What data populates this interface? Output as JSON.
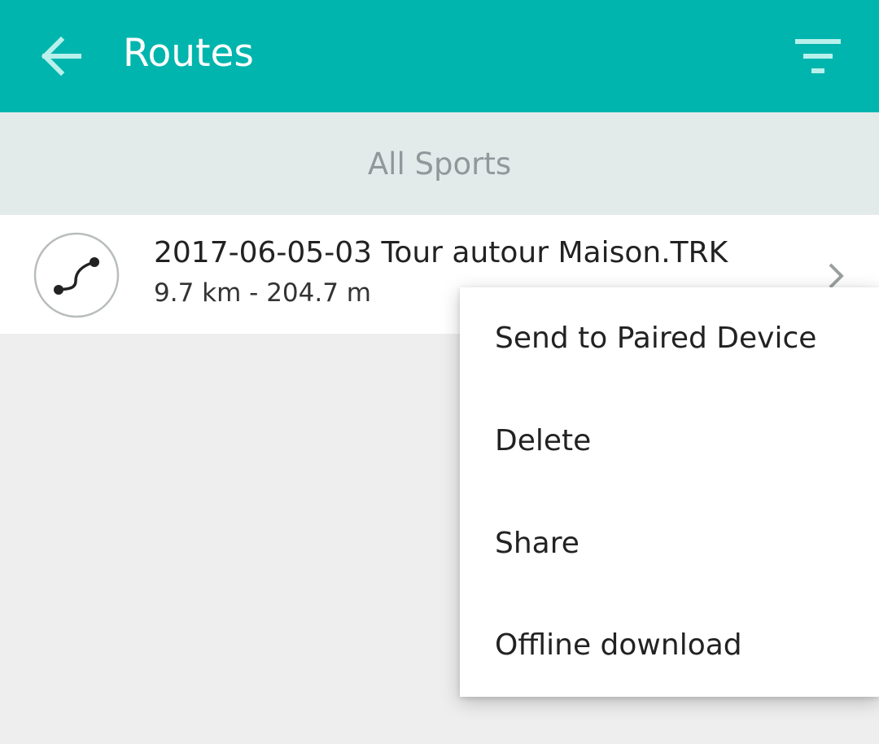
{
  "app_bar": {
    "title": "Routes",
    "background_color": "#00b5ad",
    "back_icon": "arrow-left-icon",
    "filter_icon": "filter-icon"
  },
  "filter": {
    "label": "All Sports"
  },
  "routes": [
    {
      "name": "2017-06-05-03 Tour autour Maison.TRK",
      "details": "9.7 km - 204.7 m",
      "icon": "route-path-icon"
    }
  ],
  "context_menu": {
    "items": [
      {
        "label": "Send to Paired Device"
      },
      {
        "label": "Delete"
      },
      {
        "label": "Share"
      },
      {
        "label": "Offline download"
      }
    ]
  }
}
